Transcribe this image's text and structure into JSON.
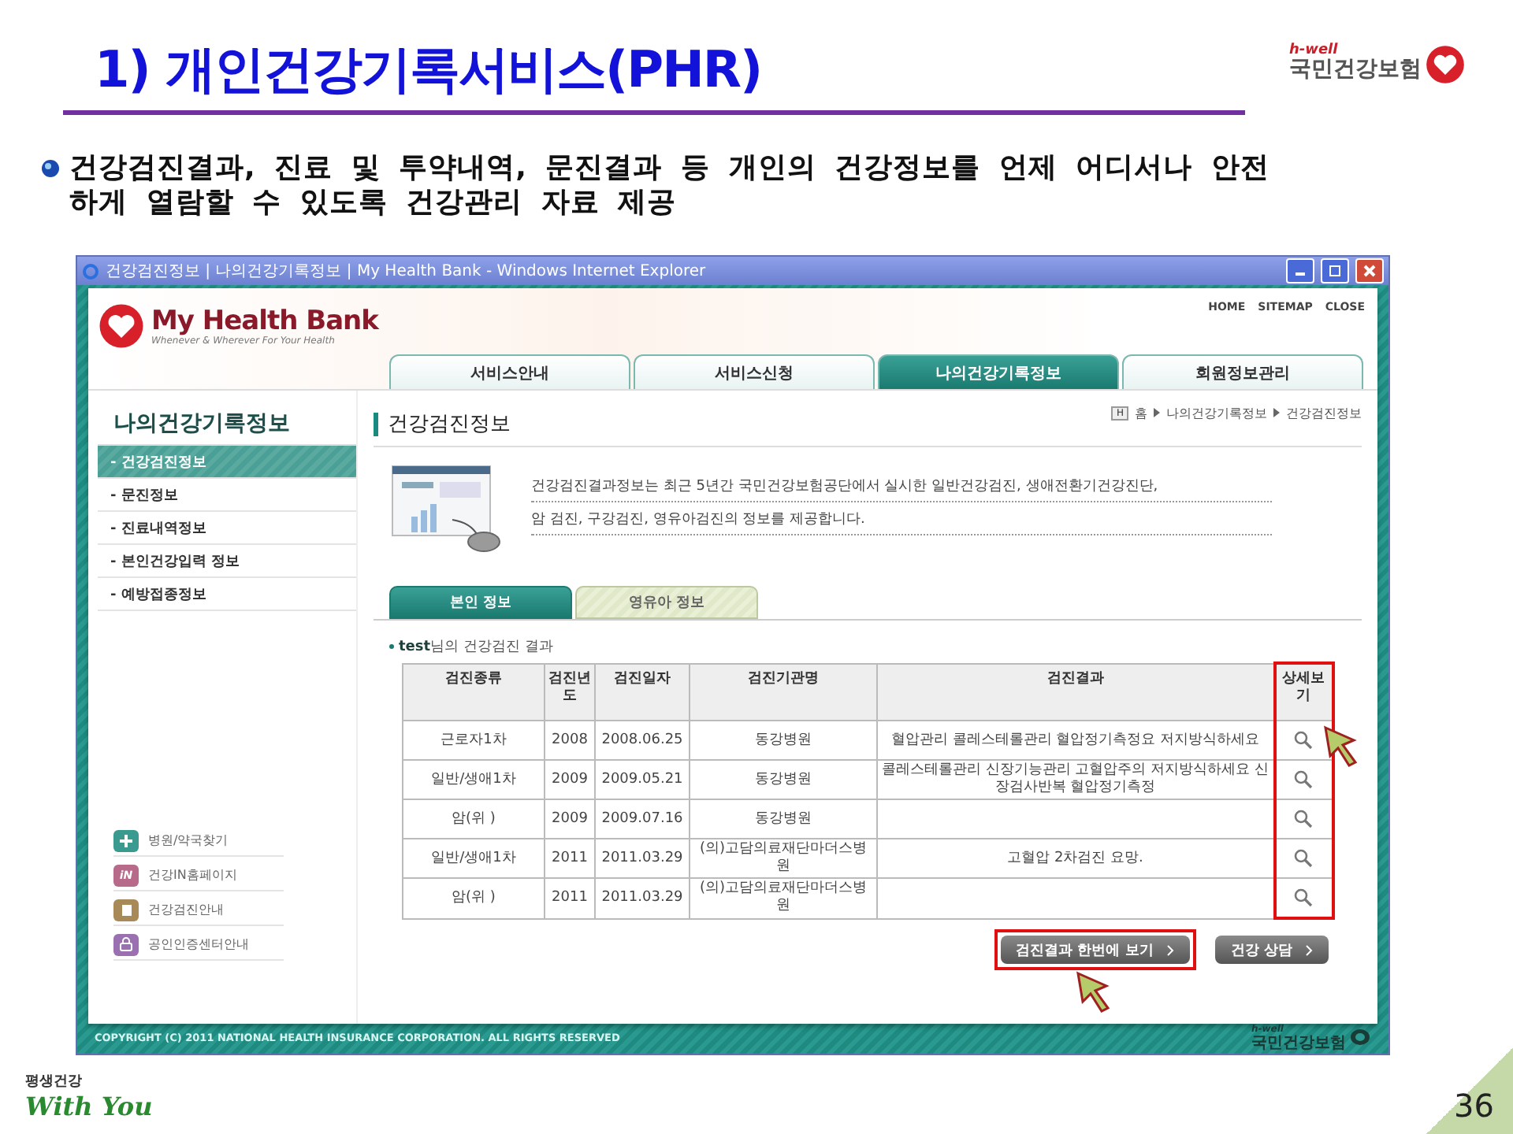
{
  "slide": {
    "title": "1) 개인건강기록서비스(PHR)",
    "logo": {
      "tagline": "h-well",
      "name": "국민건강보험"
    },
    "bullet": "건강검진결과, 진료 및 투약내역, 문진결과 등 개인의 건강정보를 언제 어디서나 안전하게 열람할 수 있도록 건강관리 자료 제공",
    "footer_logo": {
      "slogan": "평생건강",
      "signature": "With You"
    },
    "page_number": "36"
  },
  "browser": {
    "title": "건강검진정보 | 나의건강기록정보 | My Health Bank - Windows Internet Explorer",
    "site": {
      "brand": "My Health Bank",
      "tagline": "Whenever & Wherever For Your Health",
      "top_links": [
        "HOME",
        "SITEMAP",
        "CLOSE"
      ],
      "nav_tabs": [
        {
          "label": "서비스안내",
          "selected": false
        },
        {
          "label": "서비스신청",
          "selected": false
        },
        {
          "label": "나의건강기록정보",
          "selected": true
        },
        {
          "label": "회원정보관리",
          "selected": false
        }
      ],
      "sidebar": {
        "title": "나의건강기록정보",
        "items": [
          {
            "label": "- 건강검진정보",
            "selected": true
          },
          {
            "label": "- 문진정보",
            "selected": false
          },
          {
            "label": "- 진료내역정보",
            "selected": false
          },
          {
            "label": "- 본인건강입력 정보",
            "selected": false
          },
          {
            "label": "- 예방접종정보",
            "selected": false
          }
        ],
        "quick_links": [
          {
            "label": "병원/약국찾기",
            "kind": "plus",
            "color": "#3a9a90"
          },
          {
            "label": "건강IN홈페이지",
            "kind": "text",
            "badge": "iN",
            "color": "#b86a8a"
          },
          {
            "label": "건강검진안내",
            "kind": "book",
            "color": "#a88a58"
          },
          {
            "label": "공인인증센터안내",
            "kind": "lock",
            "color": "#9a70b0"
          }
        ]
      },
      "content": {
        "title": "건강검진정보",
        "breadcrumb": {
          "badge": "H",
          "items": [
            "홈",
            "나의건강기록정보",
            "건강검진정보"
          ]
        },
        "intro": [
          "건강검진결과정보는 최근 5년간 국민건강보험공단에서 실시한 일반건강검진, 생애전환기건강진단,",
          "암 검진, 구강검진, 영유아검진의 정보를 제공합니다."
        ],
        "sub_tabs": [
          {
            "label": "본인 정보",
            "selected": true
          },
          {
            "label": "영유아 정보",
            "selected": false
          }
        ],
        "caption": "**test**님의 건강검진 결과",
        "table": {
          "columns": [
            {
              "label": "검진종류",
              "highlighted": false
            },
            {
              "label": "검진년도",
              "highlighted": false
            },
            {
              "label": "검진일자",
              "highlighted": false
            },
            {
              "label": "검진기관명",
              "highlighted": false
            },
            {
              "label": "검진결과",
              "highlighted": false
            },
            {
              "label": "상세보기",
              "highlighted": true
            }
          ],
          "rows": [
            {
              "cells": [
                "근로자1차",
                "2008",
                "2008.06.25",
                "동강병원",
                "혈압관리 콜레스테롤관리 혈압정기측정요 저지방식하세요"
              ]
            },
            {
              "cells": [
                "일반/생애1차",
                "2009",
                "2009.05.21",
                "동강병원",
                "콜레스테롤관리 신장기능관리 고혈압주의 저지방식하세요 신장검사반복 혈압정기측정"
              ]
            },
            {
              "cells": [
                "암(위 )",
                "2009",
                "2009.07.16",
                "동강병원",
                ""
              ]
            },
            {
              "cells": [
                "일반/생애1차",
                "2011",
                "2011.03.29",
                "(의)고담의료재단마더스병원",
                "고혈압 2차검진 요망."
              ]
            },
            {
              "cells": [
                "암(위 )",
                "2011",
                "2011.03.29",
                "(의)고담의료재단마더스병원",
                ""
              ]
            }
          ]
        },
        "buttons": [
          {
            "label": "검진결과 한번에 보기",
            "highlighted": true
          },
          {
            "label": "건강 상담",
            "highlighted": false
          }
        ]
      },
      "footer": {
        "copyright": "COPYRIGHT (C) 2011 NATIONAL HEALTH INSURANCE CORPORATION. ALL RIGHTS RESERVED",
        "logo": {
          "tagline": "h-well",
          "name": "국민건강보험"
        }
      }
    }
  }
}
